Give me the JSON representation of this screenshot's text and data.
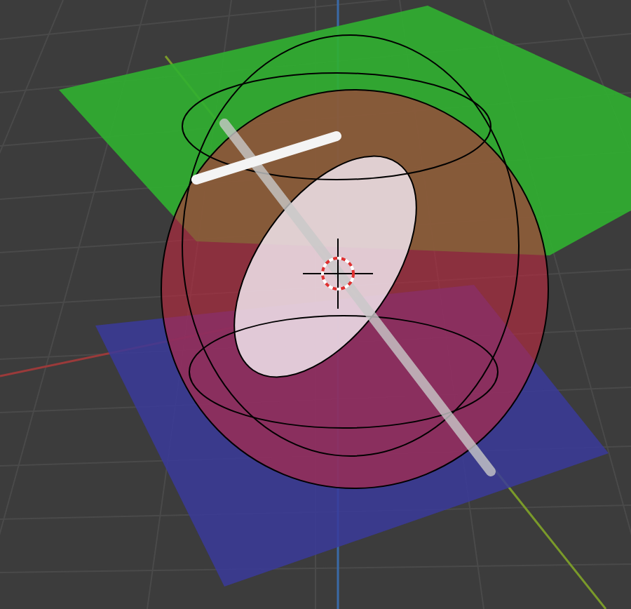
{
  "viewport": {
    "kind": "scene",
    "cursor_visible": true
  }
}
